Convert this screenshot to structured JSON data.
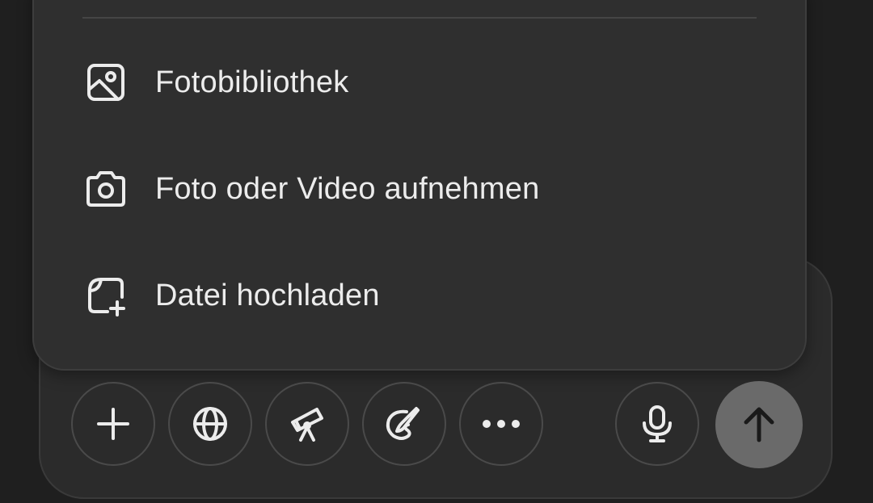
{
  "menu": {
    "items": [
      {
        "label": "Fotobibliothek",
        "icon": "photo-library-icon"
      },
      {
        "label": "Foto oder Video aufnehmen",
        "icon": "camera-icon"
      },
      {
        "label": "Datei hochladen",
        "icon": "file-upload-icon"
      }
    ]
  },
  "toolbar": {
    "buttons": [
      {
        "icon": "plus-icon"
      },
      {
        "icon": "globe-icon"
      },
      {
        "icon": "telescope-icon"
      },
      {
        "icon": "paintbrush-icon"
      },
      {
        "icon": "more-icon"
      },
      {
        "icon": "microphone-icon"
      },
      {
        "icon": "send-arrow-icon"
      }
    ]
  },
  "colors": {
    "background": "#1f1f1f",
    "popup": "#2f2f2f",
    "text": "#ececec",
    "send_button": "#6a6a6a"
  }
}
